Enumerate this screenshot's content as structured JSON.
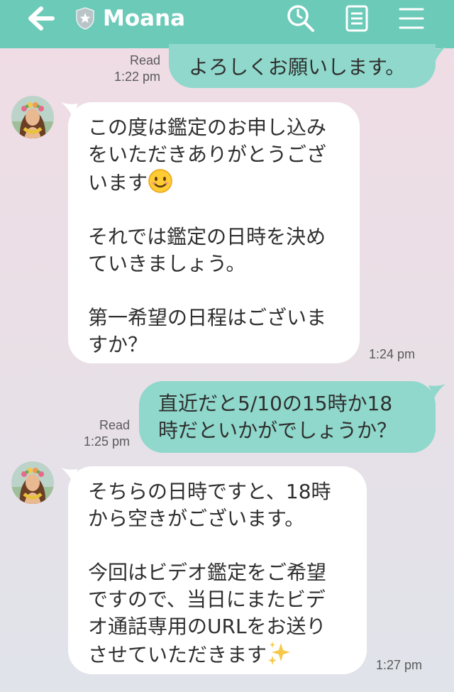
{
  "header": {
    "title": "Moana",
    "back_icon": "back-arrow-icon",
    "badge_icon": "shield-star-icon",
    "search_icon": "search-icon",
    "notes_icon": "notes-icon",
    "menu_icon": "menu-icon",
    "bg_color": "#6ccab9"
  },
  "colors": {
    "outgoing_bubble": "#8fd8cb",
    "incoming_bubble": "#ffffff"
  },
  "messages": [
    {
      "direction": "out",
      "text": "よろしくお願いします。",
      "read": "Read",
      "time": "1:22 pm"
    },
    {
      "direction": "in",
      "lines": [
        "この度は鑑定のお申し込み",
        "をいただきありがとうござ",
        "います",
        "",
        "それでは鑑定の日時を決め",
        "ていきましょう。",
        "",
        "第一希望の日程はございま",
        "すか？"
      ],
      "emoji": "smiling-face-emoji",
      "time": "1:24 pm"
    },
    {
      "direction": "out",
      "lines": [
        "直近だと5/10の15時か18",
        "時だといかがでしょうか？"
      ],
      "read": "Read",
      "time": "1:25 pm"
    },
    {
      "direction": "in",
      "lines": [
        "そちらの日時ですと、18時",
        "から空きがございます。",
        "",
        "今回はビデオ鑑定をご希望",
        "ですので、当日にまたビデ",
        "オ通話専用のURLをお送り",
        "させていただきます"
      ],
      "emoji": "sparkles-emoji",
      "time": "1:27 pm"
    }
  ]
}
